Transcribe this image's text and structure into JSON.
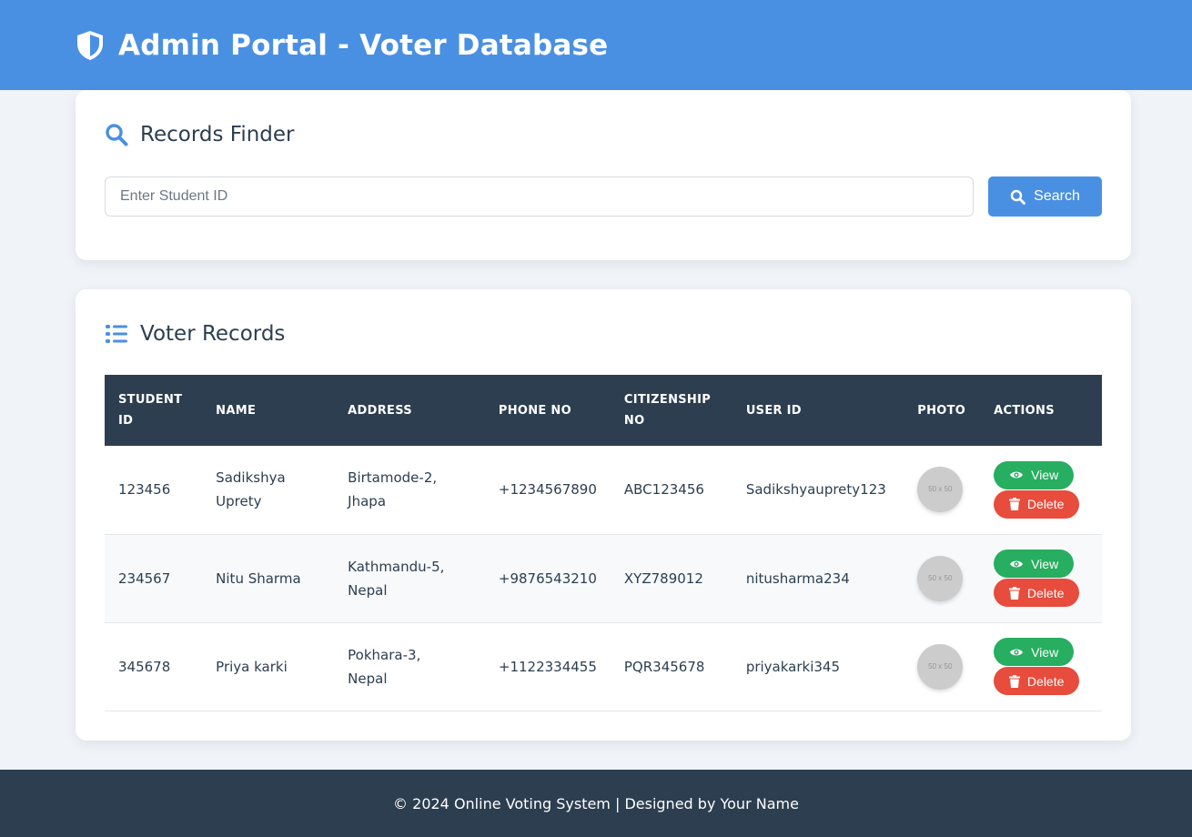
{
  "header": {
    "title": "Admin Portal - Voter Database",
    "icon": "shield-icon"
  },
  "finder": {
    "title": "Records Finder",
    "icon": "search-icon",
    "search_placeholder": "Enter Student ID",
    "search_value": "",
    "search_button_label": "Search"
  },
  "records": {
    "title": "Voter Records",
    "icon": "list-icon",
    "columns": [
      "STUDENT ID",
      "NAME",
      "ADDRESS",
      "PHONE NO",
      "CITIZENSHIP NO",
      "USER ID",
      "PHOTO",
      "ACTIONS"
    ],
    "rows": [
      {
        "student_id": "123456",
        "name": "Sadikshya Uprety",
        "address": "Birtamode-2, Jhapa",
        "phone": "+1234567890",
        "citizenship": "ABC123456",
        "user_id": "Sadikshyauprety123",
        "photo_placeholder": "50 x 50",
        "view_label": "View",
        "delete_label": "Delete"
      },
      {
        "student_id": "234567",
        "name": "Nitu Sharma",
        "address": "Kathmandu-5, Nepal",
        "phone": "+9876543210",
        "citizenship": "XYZ789012",
        "user_id": "nitusharma234",
        "photo_placeholder": "50 x 50",
        "view_label": "View",
        "delete_label": "Delete"
      },
      {
        "student_id": "345678",
        "name": "Priya karki",
        "address": "Pokhara-3, Nepal",
        "phone": "+1122334455",
        "citizenship": "PQR345678",
        "user_id": "priyakarki345",
        "photo_placeholder": "50 x 50",
        "view_label": "View",
        "delete_label": "Delete"
      }
    ]
  },
  "footer": {
    "text": "© 2024 Online Voting System | Designed by Your Name"
  },
  "colors": {
    "header_bg": "#4a90e2",
    "table_header_bg": "#2c3e50",
    "view_button": "#27ae60",
    "delete_button": "#e74c3c",
    "footer_bg": "#2c3e50"
  }
}
